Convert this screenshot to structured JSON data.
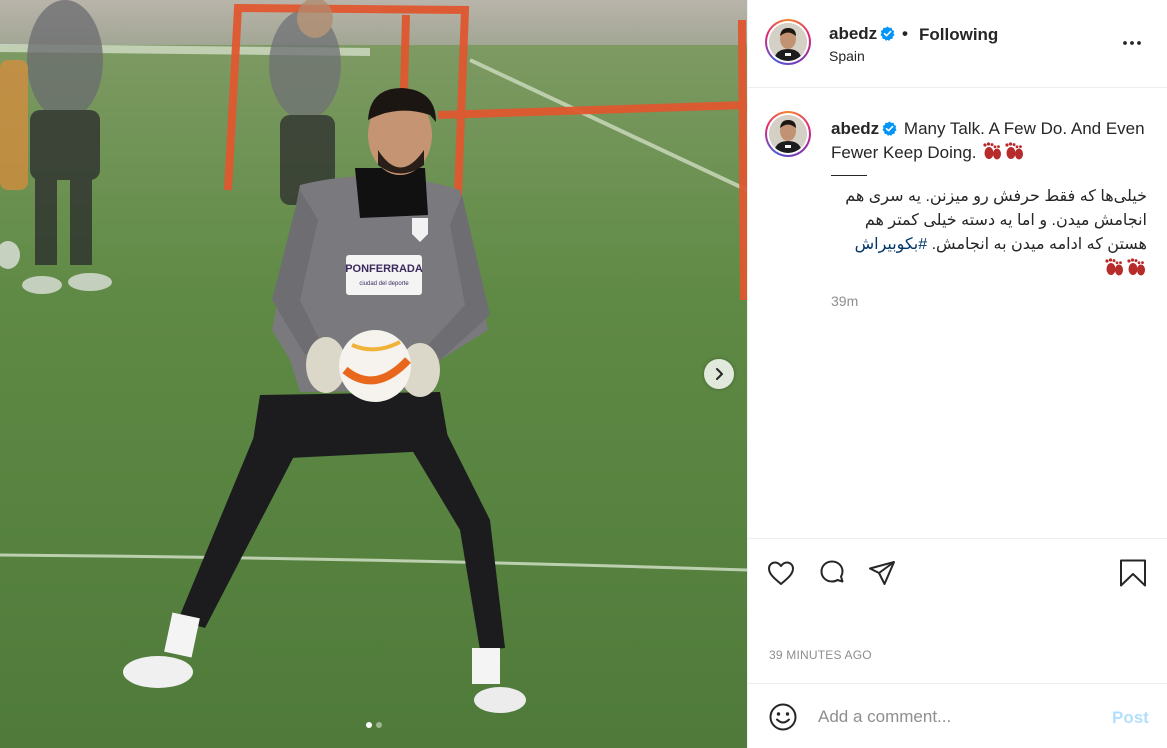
{
  "header": {
    "username": "abedz",
    "separator": "•",
    "follow_status": "Following",
    "location": "Spain",
    "more_icon": "more-horizontal-icon"
  },
  "media": {
    "sponsor_text": "PONFERRADA",
    "sponsor_subtext": "ciudad del deporte",
    "carousel": {
      "count": 2,
      "active_index": 1
    },
    "next_icon": "chevron-right-icon"
  },
  "caption": {
    "username": "abedz",
    "text": "Many Talk. A Few Do. And Even Fewer Keep Doing.",
    "persian_text": "خیلی‌ها که فقط حرفش رو میزنن. یه سری هم انجامش میدن. و اما یه دسته خیلی کمتر هم هستن که ادامه میدن به انجامش.",
    "hashtag": "#بکوبیراش",
    "time_ago": "39m",
    "emoji_name": "footprints-emoji"
  },
  "actions": {
    "like_icon": "heart-icon",
    "comment_icon": "comment-icon",
    "share_icon": "paper-plane-icon",
    "save_icon": "bookmark-icon"
  },
  "posted_ago": "39 MINUTES AGO",
  "comment_box": {
    "placeholder": "Add a comment...",
    "post_label": "Post",
    "emoji_icon": "smiley-icon"
  },
  "colors": {
    "text": "#262626",
    "secondary": "#8e8e8e",
    "link": "#00376b",
    "verified": "#0095f6",
    "post_disabled": "#b2dffc",
    "pitch_green": "#5b7a4a",
    "jersey_gray": "#7a7a7e"
  }
}
